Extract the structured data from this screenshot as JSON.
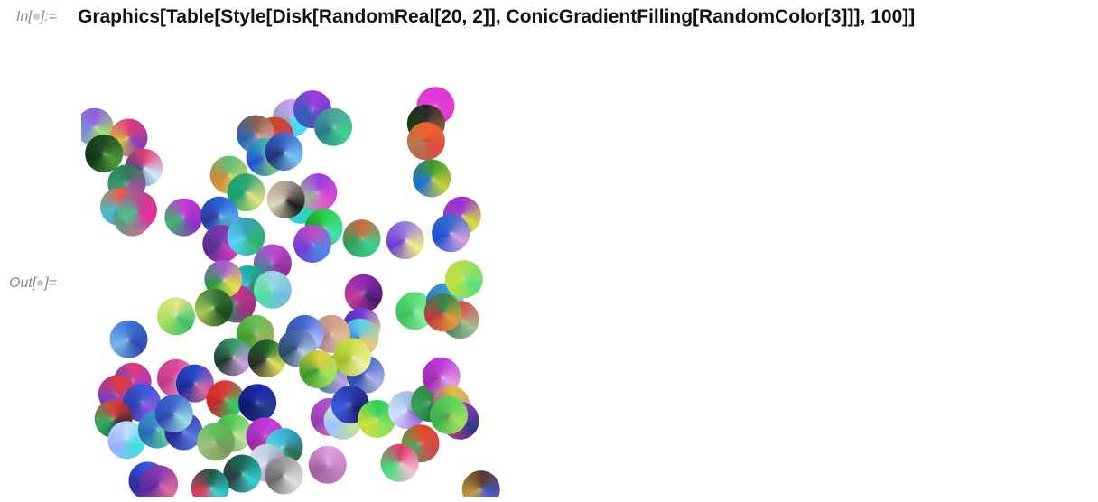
{
  "cells": {
    "input": {
      "prefix": "In[",
      "suffix": "]:=",
      "code": "Graphics[Table[Style[Disk[RandomReal[20, 2]], ConicGradientFilling[RandomColor[3]]], 100]]"
    },
    "output": {
      "prefix": "Out[",
      "suffix": "]="
    }
  },
  "graphic": {
    "domain": [
      0,
      20
    ],
    "radius": 1,
    "disks": [
      {
        "c": [
          -0.5,
          17.7
        ],
        "colors": [
          "#8e5de0",
          "#a6e36a",
          "#7b8bd6"
        ]
      },
      {
        "c": [
          1.3,
          17.1
        ],
        "colors": [
          "#e0397a",
          "#8a3db5",
          "#d6c33a"
        ]
      },
      {
        "c": [
          0.0,
          16.2
        ],
        "colors": [
          "#1e4f1f",
          "#4c9a3c",
          "#0f3415"
        ]
      },
      {
        "c": [
          2.1,
          15.4
        ],
        "colors": [
          "#e43c7a",
          "#cfeaff",
          "#2e4a7f"
        ]
      },
      {
        "c": [
          1.2,
          14.5
        ],
        "colors": [
          "#2f7a5c",
          "#a94e9a",
          "#3a9a6b"
        ]
      },
      {
        "c": [
          0.8,
          13.2
        ],
        "colors": [
          "#e75d4d",
          "#9d5bd9",
          "#44c0c4"
        ]
      },
      {
        "c": [
          1.5,
          12.6
        ],
        "colors": [
          "#2ac2e3",
          "#e06b8f",
          "#5d9a7a"
        ]
      },
      {
        "c": [
          1.8,
          13.0
        ],
        "colors": [
          "#b94a8d",
          "#ec2a9c",
          "#4ac58a"
        ]
      },
      {
        "c": [
          4.2,
          12.6
        ],
        "colors": [
          "#c63ad9",
          "#8f2ec9",
          "#3bb86a"
        ]
      },
      {
        "c": [
          9.9,
          18.2
        ],
        "colors": [
          "#c9a3ff",
          "#3de3ff",
          "#8aa0b2"
        ]
      },
      {
        "c": [
          11.0,
          18.7
        ],
        "colors": [
          "#9e3ae0",
          "#6d42cc",
          "#2f5db7"
        ]
      },
      {
        "c": [
          12.1,
          17.7
        ],
        "colors": [
          "#4ea39e",
          "#3fd38a",
          "#2a7a8d"
        ]
      },
      {
        "c": [
          9.0,
          17.2
        ],
        "colors": [
          "#d1451f",
          "#b33d8b",
          "#1f9b77"
        ]
      },
      {
        "c": [
          8.0,
          17.3
        ],
        "colors": [
          "#8d5e4c",
          "#e0a3a3",
          "#1f69b0"
        ]
      },
      {
        "c": [
          8.5,
          16.0
        ],
        "colors": [
          "#3db7b0",
          "#82e36a",
          "#1e4fd4"
        ]
      },
      {
        "c": [
          9.5,
          16.3
        ],
        "colors": [
          "#3e6dd2",
          "#79c5ef",
          "#1f2f7a"
        ]
      },
      {
        "c": [
          6.6,
          15.0
        ],
        "colors": [
          "#5ec17a",
          "#c9d65e",
          "#d0873a"
        ]
      },
      {
        "c": [
          7.5,
          14.0
        ],
        "colors": [
          "#2ea57a",
          "#e8e17a",
          "#1a9f6e"
        ]
      },
      {
        "c": [
          10.4,
          13.3
        ],
        "colors": [
          "#d37a1c",
          "#2cd2a3",
          "#3bd0ff"
        ]
      },
      {
        "c": [
          11.3,
          14.0
        ],
        "colors": [
          "#9c3ce0",
          "#e449cf",
          "#a0b3a0"
        ]
      },
      {
        "c": [
          9.6,
          13.6
        ],
        "colors": [
          "#aa9d8e",
          "#1b1b1b",
          "#ddd6b6"
        ]
      },
      {
        "c": [
          17.5,
          18.9
        ],
        "colors": [
          "#e232d8",
          "#dd3fc6",
          "#d94bc5"
        ]
      },
      {
        "c": [
          17.0,
          17.9
        ],
        "colors": [
          "#2a2a2a",
          "#9b5c3a",
          "#1d3b0b"
        ]
      },
      {
        "c": [
          17.0,
          16.9
        ],
        "colors": [
          "#f0642a",
          "#d94a44",
          "#b1774c"
        ]
      },
      {
        "c": [
          17.3,
          14.8
        ],
        "colors": [
          "#3b9a2a",
          "#c8d03f",
          "#1f6dd6"
        ]
      },
      {
        "c": [
          18.9,
          12.7
        ],
        "colors": [
          "#9a2fd2",
          "#d7e13c",
          "#9d3ccf"
        ]
      },
      {
        "c": [
          18.3,
          11.7
        ],
        "colors": [
          "#3a6fc8",
          "#d6a0e0",
          "#1e4fd4"
        ]
      },
      {
        "c": [
          15.9,
          11.3
        ],
        "colors": [
          "#9b7fe0",
          "#f1f08a",
          "#6d3cd2"
        ]
      },
      {
        "c": [
          13.6,
          11.4
        ],
        "colors": [
          "#d06a3a",
          "#3ad18a",
          "#2ea05f"
        ]
      },
      {
        "c": [
          11.6,
          12.0
        ],
        "colors": [
          "#24d24a",
          "#4ae0b0",
          "#1c8a2a"
        ]
      },
      {
        "c": [
          11.0,
          11.1
        ],
        "colors": [
          "#c54dc8",
          "#4b89e8",
          "#6d3cd2"
        ]
      },
      {
        "c": [
          6.1,
          12.7
        ],
        "colors": [
          "#2a63d6",
          "#5cb5f0",
          "#2a3a9a"
        ]
      },
      {
        "c": [
          6.9,
          11.6
        ],
        "colors": [
          "#5aa0ec",
          "#5db75a",
          "#2f9a7a"
        ]
      },
      {
        "c": [
          6.2,
          11.1
        ],
        "colors": [
          "#7a3ab0",
          "#d43ac3",
          "#5a2a90"
        ]
      },
      {
        "c": [
          7.5,
          11.5
        ],
        "colors": [
          "#3aa0b0",
          "#2ab76a",
          "#5ad0ff"
        ]
      },
      {
        "c": [
          8.9,
          10.0
        ],
        "colors": [
          "#c24ad0",
          "#8c2d9e",
          "#4e7e9e"
        ]
      },
      {
        "c": [
          7.6,
          8.8
        ],
        "colors": [
          "#1fb0a3",
          "#2f7d5a",
          "#33b6ff"
        ]
      },
      {
        "c": [
          8.9,
          8.5
        ],
        "colors": [
          "#a0d6e6",
          "#6dbde0",
          "#52e0a0"
        ]
      },
      {
        "c": [
          7.0,
          7.7
        ],
        "colors": [
          "#c1398e",
          "#9d2f7a",
          "#2d8b6a"
        ]
      },
      {
        "c": [
          6.3,
          9.1
        ],
        "colors": [
          "#a85ad6",
          "#e7e24a",
          "#2a9a4a"
        ]
      },
      {
        "c": [
          5.8,
          7.5
        ],
        "colors": [
          "#3d7a3a",
          "#1a4a1a",
          "#a6c85a"
        ]
      },
      {
        "c": [
          3.8,
          7.0
        ],
        "colors": [
          "#e0e68a",
          "#3bc06a",
          "#a6e05a"
        ]
      },
      {
        "c": [
          1.3,
          5.7
        ],
        "colors": [
          "#3a72d2",
          "#2a4ab0",
          "#7ab6ea"
        ]
      },
      {
        "c": [
          13.7,
          8.3
        ],
        "colors": [
          "#8b2ab0",
          "#4a1a6a",
          "#c23a9a"
        ]
      },
      {
        "c": [
          13.6,
          6.4
        ],
        "colors": [
          "#7a3ae0",
          "#e8f48a",
          "#2a2ab0"
        ]
      },
      {
        "c": [
          13.5,
          5.8
        ],
        "colors": [
          "#5ad0ea",
          "#e8c87a",
          "#3a7ad2"
        ]
      },
      {
        "c": [
          12.0,
          6.0
        ],
        "colors": [
          "#d0a08a",
          "#e0c090",
          "#a67a9a"
        ]
      },
      {
        "c": [
          10.6,
          6.0
        ],
        "colors": [
          "#4a6ad0",
          "#b0c0ff",
          "#2a4a9a"
        ]
      },
      {
        "c": [
          8.0,
          6.0
        ],
        "colors": [
          "#6ac05a",
          "#a0b05a",
          "#3a9a2a"
        ]
      },
      {
        "c": [
          16.4,
          7.3
        ],
        "colors": [
          "#5ae07a",
          "#8af0a0",
          "#3ac05a"
        ]
      },
      {
        "c": [
          18.0,
          7.8
        ],
        "colors": [
          "#3a9ad0",
          "#b0e0f0",
          "#2a6ab0"
        ]
      },
      {
        "c": [
          18.8,
          6.8
        ],
        "colors": [
          "#e04a4a",
          "#a0c090",
          "#3a7a5a"
        ]
      },
      {
        "c": [
          17.9,
          7.2
        ],
        "colors": [
          "#2a8a4a",
          "#e0a03a",
          "#c03a3a"
        ]
      },
      {
        "c": [
          19.0,
          9.1
        ],
        "colors": [
          "#aade5a",
          "#5ae07a",
          "#c0e03a"
        ]
      },
      {
        "c": [
          6.8,
          4.7
        ],
        "colors": [
          "#3a9a6a",
          "#d0a0e0",
          "#1a3a2a"
        ]
      },
      {
        "c": [
          8.6,
          4.6
        ],
        "colors": [
          "#1a6a2a",
          "#e0e060",
          "#2a2a2a"
        ]
      },
      {
        "c": [
          10.2,
          5.2
        ],
        "colors": [
          "#4a6ab0",
          "#c0d0e0",
          "#2a4a6a"
        ]
      },
      {
        "c": [
          12.0,
          3.7
        ],
        "colors": [
          "#3a9ab0",
          "#c0a0e0",
          "#2a7a8a"
        ]
      },
      {
        "c": [
          13.8,
          3.7
        ],
        "colors": [
          "#3a6ad0",
          "#b0b0e0",
          "#2a4ab0"
        ]
      },
      {
        "c": [
          13.1,
          4.7
        ],
        "colors": [
          "#d0e04a",
          "#f0f0a0",
          "#a0c02a"
        ]
      },
      {
        "c": [
          11.3,
          4.0
        ],
        "colors": [
          "#e0d03a",
          "#a0e060",
          "#3a9a2a"
        ]
      },
      {
        "c": [
          1.5,
          3.3
        ],
        "colors": [
          "#e03a7a",
          "#9a3ad0",
          "#3a4ad0"
        ]
      },
      {
        "c": [
          0.7,
          2.6
        ],
        "colors": [
          "#e03a3a",
          "#c03a8a",
          "#7a3ad0"
        ]
      },
      {
        "c": [
          3.8,
          3.5
        ],
        "colors": [
          "#e04a9a",
          "#f0a0c0",
          "#c03a8a"
        ]
      },
      {
        "c": [
          4.8,
          3.2
        ],
        "colors": [
          "#2a4ad0",
          "#e06aa0",
          "#1a2a9a"
        ]
      },
      {
        "c": [
          2.0,
          2.1
        ],
        "colors": [
          "#3a5ad0",
          "#8a5ae0",
          "#2a3ab0"
        ]
      },
      {
        "c": [
          6.4,
          2.3
        ],
        "colors": [
          "#e03a3a",
          "#2ad060",
          "#c02a2a"
        ]
      },
      {
        "c": [
          8.1,
          2.1
        ],
        "colors": [
          "#1a2ab0",
          "#2a3a8a",
          "#0a1a6a"
        ]
      },
      {
        "c": [
          0.5,
          1.2
        ],
        "colors": [
          "#e03a3a",
          "#2a2a2a",
          "#2ab060"
        ]
      },
      {
        "c": [
          1.2,
          0.0
        ],
        "colors": [
          "#c0e0ff",
          "#3ae0e0",
          "#a0b0ff"
        ]
      },
      {
        "c": [
          2.8,
          0.6
        ],
        "colors": [
          "#3a9ad0",
          "#5ad0a0",
          "#2a6ab0"
        ]
      },
      {
        "c": [
          4.2,
          0.5
        ],
        "colors": [
          "#3a3ab0",
          "#5a7ae0",
          "#2a2a9a"
        ]
      },
      {
        "c": [
          3.7,
          1.5
        ],
        "colors": [
          "#3a6ad0",
          "#9ae0e0",
          "#2a4ab0"
        ]
      },
      {
        "c": [
          6.8,
          0.4
        ],
        "colors": [
          "#5ad05a",
          "#c0e0a0",
          "#3a9a3a"
        ]
      },
      {
        "c": [
          8.5,
          0.2
        ],
        "colors": [
          "#c03ae0",
          "#e03a9a",
          "#9a2ab0"
        ]
      },
      {
        "c": [
          9.5,
          -0.4
        ],
        "colors": [
          "#3ab0e0",
          "#2a6a4a",
          "#5ae0d0"
        ]
      },
      {
        "c": [
          8.6,
          -1.3
        ],
        "colors": [
          "#c0d0e0",
          "#7a7a9a",
          "#e0e0f0"
        ]
      },
      {
        "c": [
          11.9,
          1.3
        ],
        "colors": [
          "#b05ad0",
          "#e0a0c0",
          "#9a3ab0"
        ]
      },
      {
        "c": [
          12.6,
          1.1
        ],
        "colors": [
          "#e0f0c0",
          "#c0e0a0",
          "#a0c0ff"
        ]
      },
      {
        "c": [
          13.0,
          2.0
        ],
        "colors": [
          "#2a3ab0",
          "#1a1a6a",
          "#3a5ae0"
        ]
      },
      {
        "c": [
          14.4,
          1.2
        ],
        "colors": [
          "#2ad05a",
          "#8ae05a",
          "#d0e03a"
        ]
      },
      {
        "c": [
          16.0,
          1.7
        ],
        "colors": [
          "#a0c0e0",
          "#9a6ae0",
          "#d0e0ff"
        ]
      },
      {
        "c": [
          17.2,
          2.1
        ],
        "colors": [
          "#2a8a3a",
          "#1a5a2a",
          "#3aa05a"
        ]
      },
      {
        "c": [
          17.8,
          3.6
        ],
        "colors": [
          "#c03ae0",
          "#e0a0e0",
          "#9a2ab0"
        ]
      },
      {
        "c": [
          18.3,
          2.0
        ],
        "colors": [
          "#e0c03a",
          "#c0a0a0",
          "#8a3ac0"
        ]
      },
      {
        "c": [
          18.8,
          1.1
        ],
        "colors": [
          "#a03ab0",
          "#2a3a8a",
          "#e03a7a"
        ]
      },
      {
        "c": [
          18.2,
          1.4
        ],
        "colors": [
          "#5ad05a",
          "#a0e060",
          "#3ab04a"
        ]
      },
      {
        "c": [
          16.7,
          -0.2
        ],
        "colors": [
          "#e04a2a",
          "#d04a4a",
          "#3ab05a"
        ]
      },
      {
        "c": [
          15.6,
          -1.3
        ],
        "colors": [
          "#e03a6a",
          "#f0c0d0",
          "#3ae07a"
        ]
      },
      {
        "c": [
          11.8,
          -1.4
        ],
        "colors": [
          "#e0a0e0",
          "#c080c0",
          "#a060a0"
        ]
      },
      {
        "c": [
          5.9,
          -0.1
        ],
        "colors": [
          "#5ac05a",
          "#7a9a5a",
          "#a0c080"
        ]
      },
      {
        "c": [
          7.3,
          -1.9
        ],
        "colors": [
          "#1a6a5a",
          "#3ad0d0",
          "#2a3a3a"
        ]
      },
      {
        "c": [
          2.3,
          -2.3
        ],
        "colors": [
          "#3a5ae0",
          "#c03ae0",
          "#2a2a9a"
        ]
      },
      {
        "c": [
          2.9,
          -2.5
        ],
        "colors": [
          "#8a3ab0",
          "#e06aa0",
          "#5a2a9a"
        ]
      },
      {
        "c": [
          5.6,
          -2.7
        ],
        "colors": [
          "#1a5a4a",
          "#3ad0d0",
          "#e03a5a"
        ]
      },
      {
        "c": [
          19.9,
          -2.8
        ],
        "colors": [
          "#5a3a2a",
          "#4a5ad0",
          "#c09a3a"
        ]
      },
      {
        "c": [
          9.5,
          -2.0
        ],
        "colors": [
          "#a0a0a0",
          "#e0e0e0",
          "#6a6a6a"
        ]
      }
    ]
  }
}
